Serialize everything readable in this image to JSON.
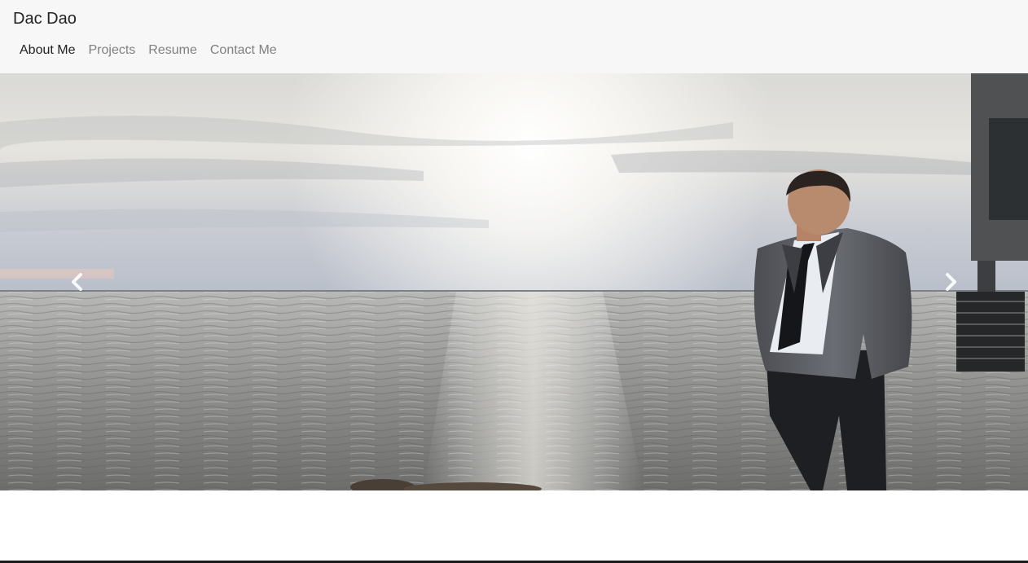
{
  "navbar": {
    "brand": "Dac Dao",
    "items": [
      {
        "label": "About Me",
        "active": true
      },
      {
        "label": "Projects",
        "active": false
      },
      {
        "label": "Resume",
        "active": false
      },
      {
        "label": "Contact Me",
        "active": false
      }
    ]
  },
  "carousel": {
    "prev_icon": "chevron-left-icon",
    "next_icon": "chevron-right-icon"
  },
  "colors": {
    "navbar_bg": "#f7f7f7",
    "active_link": "#222222",
    "inactive_link": "#808080"
  }
}
